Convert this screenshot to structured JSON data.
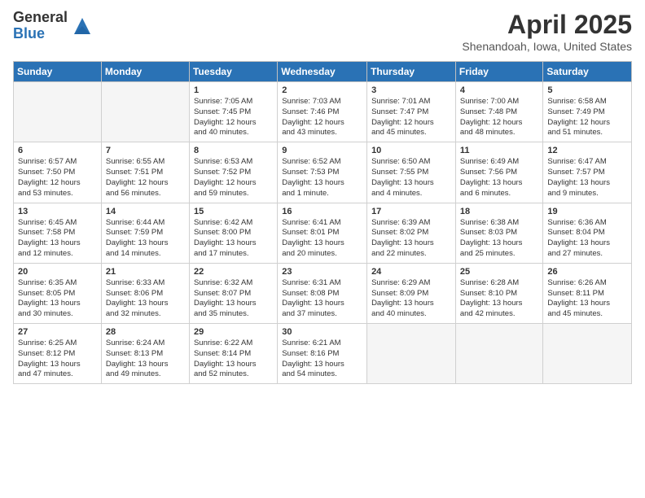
{
  "header": {
    "logo_general": "General",
    "logo_blue": "Blue",
    "month_title": "April 2025",
    "location": "Shenandoah, Iowa, United States"
  },
  "weekdays": [
    "Sunday",
    "Monday",
    "Tuesday",
    "Wednesday",
    "Thursday",
    "Friday",
    "Saturday"
  ],
  "weeks": [
    [
      {
        "day": "",
        "detail": ""
      },
      {
        "day": "",
        "detail": ""
      },
      {
        "day": "1",
        "detail": "Sunrise: 7:05 AM\nSunset: 7:45 PM\nDaylight: 12 hours\nand 40 minutes."
      },
      {
        "day": "2",
        "detail": "Sunrise: 7:03 AM\nSunset: 7:46 PM\nDaylight: 12 hours\nand 43 minutes."
      },
      {
        "day": "3",
        "detail": "Sunrise: 7:01 AM\nSunset: 7:47 PM\nDaylight: 12 hours\nand 45 minutes."
      },
      {
        "day": "4",
        "detail": "Sunrise: 7:00 AM\nSunset: 7:48 PM\nDaylight: 12 hours\nand 48 minutes."
      },
      {
        "day": "5",
        "detail": "Sunrise: 6:58 AM\nSunset: 7:49 PM\nDaylight: 12 hours\nand 51 minutes."
      }
    ],
    [
      {
        "day": "6",
        "detail": "Sunrise: 6:57 AM\nSunset: 7:50 PM\nDaylight: 12 hours\nand 53 minutes."
      },
      {
        "day": "7",
        "detail": "Sunrise: 6:55 AM\nSunset: 7:51 PM\nDaylight: 12 hours\nand 56 minutes."
      },
      {
        "day": "8",
        "detail": "Sunrise: 6:53 AM\nSunset: 7:52 PM\nDaylight: 12 hours\nand 59 minutes."
      },
      {
        "day": "9",
        "detail": "Sunrise: 6:52 AM\nSunset: 7:53 PM\nDaylight: 13 hours\nand 1 minute."
      },
      {
        "day": "10",
        "detail": "Sunrise: 6:50 AM\nSunset: 7:55 PM\nDaylight: 13 hours\nand 4 minutes."
      },
      {
        "day": "11",
        "detail": "Sunrise: 6:49 AM\nSunset: 7:56 PM\nDaylight: 13 hours\nand 6 minutes."
      },
      {
        "day": "12",
        "detail": "Sunrise: 6:47 AM\nSunset: 7:57 PM\nDaylight: 13 hours\nand 9 minutes."
      }
    ],
    [
      {
        "day": "13",
        "detail": "Sunrise: 6:45 AM\nSunset: 7:58 PM\nDaylight: 13 hours\nand 12 minutes."
      },
      {
        "day": "14",
        "detail": "Sunrise: 6:44 AM\nSunset: 7:59 PM\nDaylight: 13 hours\nand 14 minutes."
      },
      {
        "day": "15",
        "detail": "Sunrise: 6:42 AM\nSunset: 8:00 PM\nDaylight: 13 hours\nand 17 minutes."
      },
      {
        "day": "16",
        "detail": "Sunrise: 6:41 AM\nSunset: 8:01 PM\nDaylight: 13 hours\nand 20 minutes."
      },
      {
        "day": "17",
        "detail": "Sunrise: 6:39 AM\nSunset: 8:02 PM\nDaylight: 13 hours\nand 22 minutes."
      },
      {
        "day": "18",
        "detail": "Sunrise: 6:38 AM\nSunset: 8:03 PM\nDaylight: 13 hours\nand 25 minutes."
      },
      {
        "day": "19",
        "detail": "Sunrise: 6:36 AM\nSunset: 8:04 PM\nDaylight: 13 hours\nand 27 minutes."
      }
    ],
    [
      {
        "day": "20",
        "detail": "Sunrise: 6:35 AM\nSunset: 8:05 PM\nDaylight: 13 hours\nand 30 minutes."
      },
      {
        "day": "21",
        "detail": "Sunrise: 6:33 AM\nSunset: 8:06 PM\nDaylight: 13 hours\nand 32 minutes."
      },
      {
        "day": "22",
        "detail": "Sunrise: 6:32 AM\nSunset: 8:07 PM\nDaylight: 13 hours\nand 35 minutes."
      },
      {
        "day": "23",
        "detail": "Sunrise: 6:31 AM\nSunset: 8:08 PM\nDaylight: 13 hours\nand 37 minutes."
      },
      {
        "day": "24",
        "detail": "Sunrise: 6:29 AM\nSunset: 8:09 PM\nDaylight: 13 hours\nand 40 minutes."
      },
      {
        "day": "25",
        "detail": "Sunrise: 6:28 AM\nSunset: 8:10 PM\nDaylight: 13 hours\nand 42 minutes."
      },
      {
        "day": "26",
        "detail": "Sunrise: 6:26 AM\nSunset: 8:11 PM\nDaylight: 13 hours\nand 45 minutes."
      }
    ],
    [
      {
        "day": "27",
        "detail": "Sunrise: 6:25 AM\nSunset: 8:12 PM\nDaylight: 13 hours\nand 47 minutes."
      },
      {
        "day": "28",
        "detail": "Sunrise: 6:24 AM\nSunset: 8:13 PM\nDaylight: 13 hours\nand 49 minutes."
      },
      {
        "day": "29",
        "detail": "Sunrise: 6:22 AM\nSunset: 8:14 PM\nDaylight: 13 hours\nand 52 minutes."
      },
      {
        "day": "30",
        "detail": "Sunrise: 6:21 AM\nSunset: 8:16 PM\nDaylight: 13 hours\nand 54 minutes."
      },
      {
        "day": "",
        "detail": ""
      },
      {
        "day": "",
        "detail": ""
      },
      {
        "day": "",
        "detail": ""
      }
    ]
  ]
}
